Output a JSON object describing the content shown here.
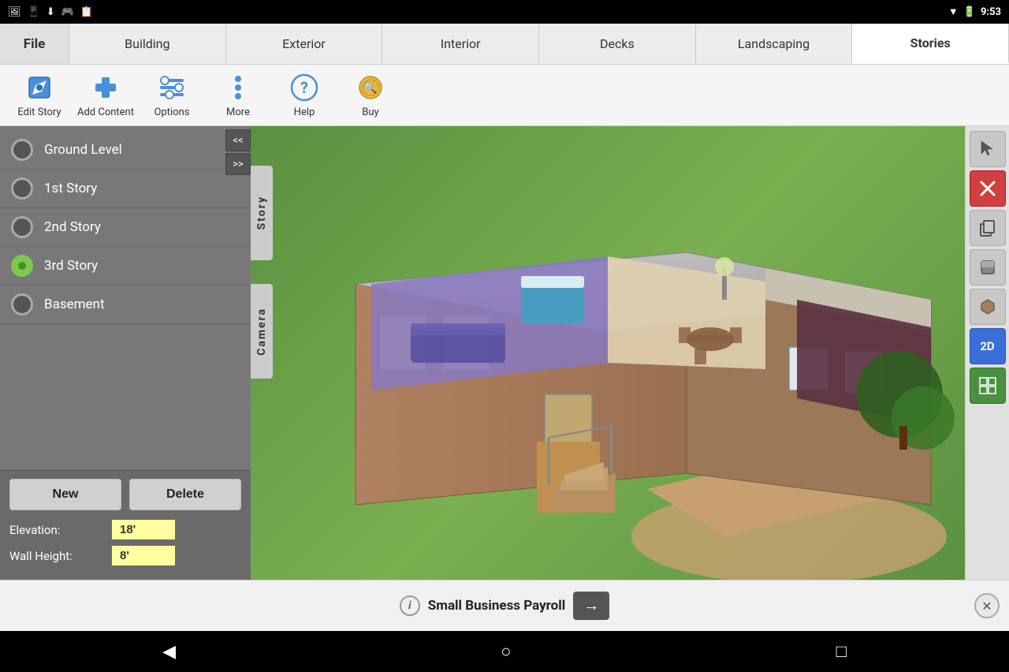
{
  "statusBar": {
    "time": "9:53",
    "icons": [
      "screenshot",
      "phone",
      "download",
      "toy",
      "notes"
    ]
  },
  "tabs": [
    {
      "id": "file",
      "label": "File",
      "active": false
    },
    {
      "id": "building",
      "label": "Building",
      "active": false
    },
    {
      "id": "exterior",
      "label": "Exterior",
      "active": false
    },
    {
      "id": "interior",
      "label": "Interior",
      "active": false
    },
    {
      "id": "decks",
      "label": "Decks",
      "active": false
    },
    {
      "id": "landscaping",
      "label": "Landscaping",
      "active": false
    },
    {
      "id": "stories",
      "label": "Stories",
      "active": true
    }
  ],
  "toolbar": {
    "editStory": {
      "label": "Edit Story",
      "icon": "✎"
    },
    "addContent": {
      "label": "Add Content",
      "icon": "➕"
    },
    "options": {
      "label": "Options",
      "icon": "📐"
    },
    "more": {
      "label": "More",
      "icon": "⋮"
    },
    "help": {
      "label": "Help",
      "icon": "?"
    },
    "buy": {
      "label": "Buy",
      "icon": "🔍"
    }
  },
  "storyPanel": {
    "arrows": {
      "up": "<<",
      "down": ">>"
    },
    "storyTab": "Story",
    "cameraTab": "Camera",
    "stories": [
      {
        "id": "ground",
        "label": "Ground Level",
        "active": false
      },
      {
        "id": "first",
        "label": "1st Story",
        "active": false
      },
      {
        "id": "second",
        "label": "2nd Story",
        "active": false
      },
      {
        "id": "third",
        "label": "3rd Story",
        "active": true
      },
      {
        "id": "basement",
        "label": "Basement",
        "active": false
      }
    ],
    "newButton": "New",
    "deleteButton": "Delete",
    "elevation": {
      "label": "Elevation:",
      "value": "18'"
    },
    "wallHeight": {
      "label": "Wall Height:",
      "value": "8'"
    }
  },
  "rightToolbar": {
    "cursor": "▶",
    "delete": "✕",
    "copy": "⎘",
    "box": "◼",
    "shape": "⬟",
    "view2d": "2D",
    "grid": "⊞"
  },
  "adBanner": {
    "infoIcon": "i",
    "text": "Small Business Payroll",
    "arrowLabel": "→",
    "closeLabel": "✕"
  },
  "navBar": {
    "back": "◀",
    "home": "○",
    "recent": "□"
  }
}
